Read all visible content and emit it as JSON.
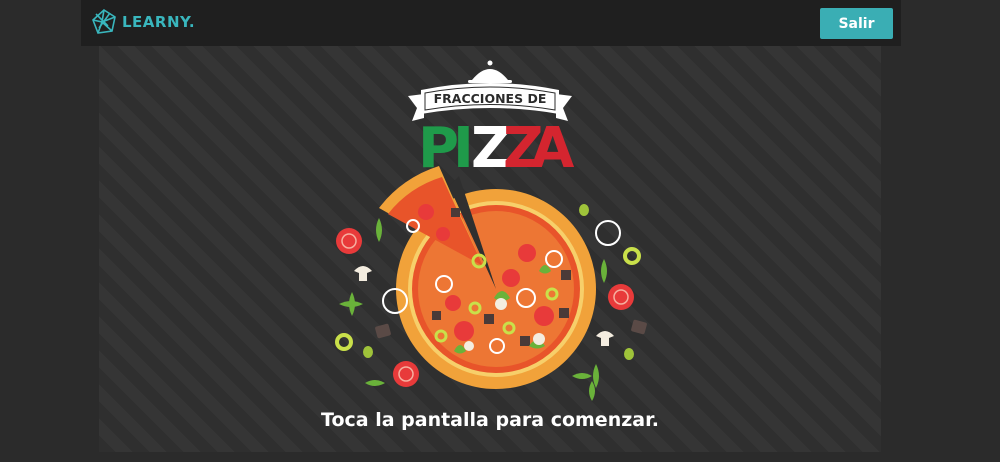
{
  "header": {
    "logo_text": "LEARNY.",
    "exit_label": "Salir"
  },
  "title": {
    "banner_text": "FRACCIONES DE",
    "pizza_letters": [
      "P",
      "I",
      "Z",
      "Z",
      "A"
    ]
  },
  "prompt": "Toca la pantalla para comenzar.",
  "colors": {
    "accent": "#3aaeb4",
    "green": "#1f9a4a",
    "white": "#ffffff",
    "red": "#d4252f"
  }
}
